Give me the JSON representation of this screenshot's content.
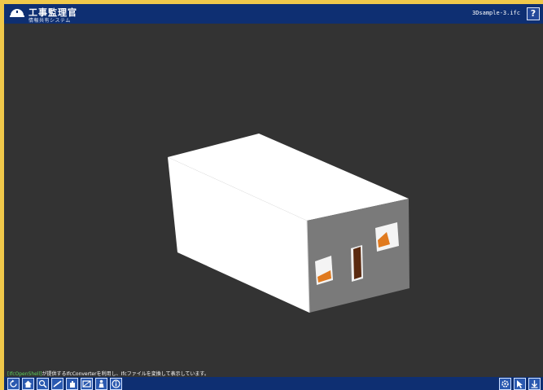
{
  "header": {
    "title": "工事監理官",
    "subtitle": "情報共有システム",
    "file_name": "3Dsample-3.ifc",
    "help_label": "?"
  },
  "footer": {
    "credit_link": "[IfcOpenShell]",
    "credit_text": "が提供するIfcConverterを利用し、Ifcファイルを変換して表示しています。"
  },
  "toolbar": {
    "left_tools": [
      "rotate-icon",
      "home-icon",
      "zoom-icon",
      "measure-icon",
      "pan-icon",
      "section-icon",
      "person-icon",
      "info-icon"
    ],
    "right_tools": [
      "settings-icon",
      "pointer-icon",
      "download-icon"
    ]
  },
  "colors": {
    "frame_border": "#f0c84a",
    "header_bg": "#0e2f72",
    "viewport_bg": "#333333",
    "model_wall": "#ffffff",
    "model_side": "#7a7a7a",
    "door": "#5a2a10",
    "window_glass": "#e07a1f"
  }
}
